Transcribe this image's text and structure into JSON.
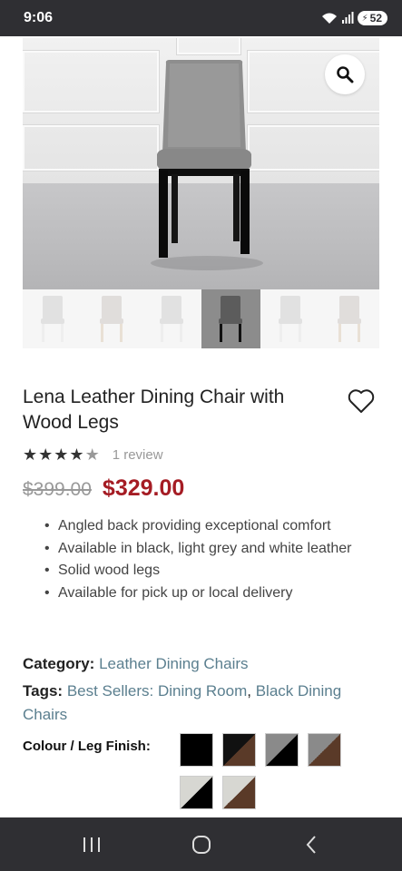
{
  "status_bar": {
    "time": "9:06",
    "battery": "52"
  },
  "hero": {
    "zoom_icon": "search-icon"
  },
  "thumbnails": [
    {
      "color": "#c9c9c9",
      "legs": "#e0e0e0",
      "active": false
    },
    {
      "color": "#c6c2be",
      "legs": "#d8c7b2",
      "active": false
    },
    {
      "color": "#c9c9c9",
      "legs": "#e0e0e0",
      "active": false
    },
    {
      "color": "#5c5c5c",
      "legs": "#111111",
      "active": true
    },
    {
      "color": "#c9c9c9",
      "legs": "#e0e0e0",
      "active": false
    },
    {
      "color": "#c6c2be",
      "legs": "#d8c7b2",
      "active": false
    }
  ],
  "product": {
    "title": "Lena Leather Dining Chair with Wood Legs",
    "rating": 4,
    "rating_max": 5,
    "review_count": "1 review",
    "old_price": "$399.00",
    "new_price": "$329.00",
    "features": [
      "Angled back providing exceptional comfort",
      "Available in black, light grey and white leather",
      "Solid wood legs",
      "Available for pick up or local delivery"
    ]
  },
  "meta": {
    "category_label": "Category:",
    "category_value": "Leather Dining Chairs",
    "tags_label": "Tags:",
    "tag_1": "Best Sellers: Dining Room",
    "tag_sep": ",",
    "tag_2": "Black Dining Chairs"
  },
  "finish": {
    "label": "Colour / Leg Finish:",
    "swatches": [
      {
        "top": "#000000",
        "bottom": "#000000"
      },
      {
        "top": "#111111",
        "bottom": "#5a3a28"
      },
      {
        "top": "#8a8a8a",
        "bottom": "#000000"
      },
      {
        "top": "#8a8a8a",
        "bottom": "#5a3a28"
      },
      {
        "top": "#d7d7d2",
        "bottom": "#000000"
      },
      {
        "top": "#d7d7d2",
        "bottom": "#5a3a28"
      }
    ]
  },
  "colors": {
    "accent_price": "#a51c24",
    "link": "#5b7f8f"
  }
}
